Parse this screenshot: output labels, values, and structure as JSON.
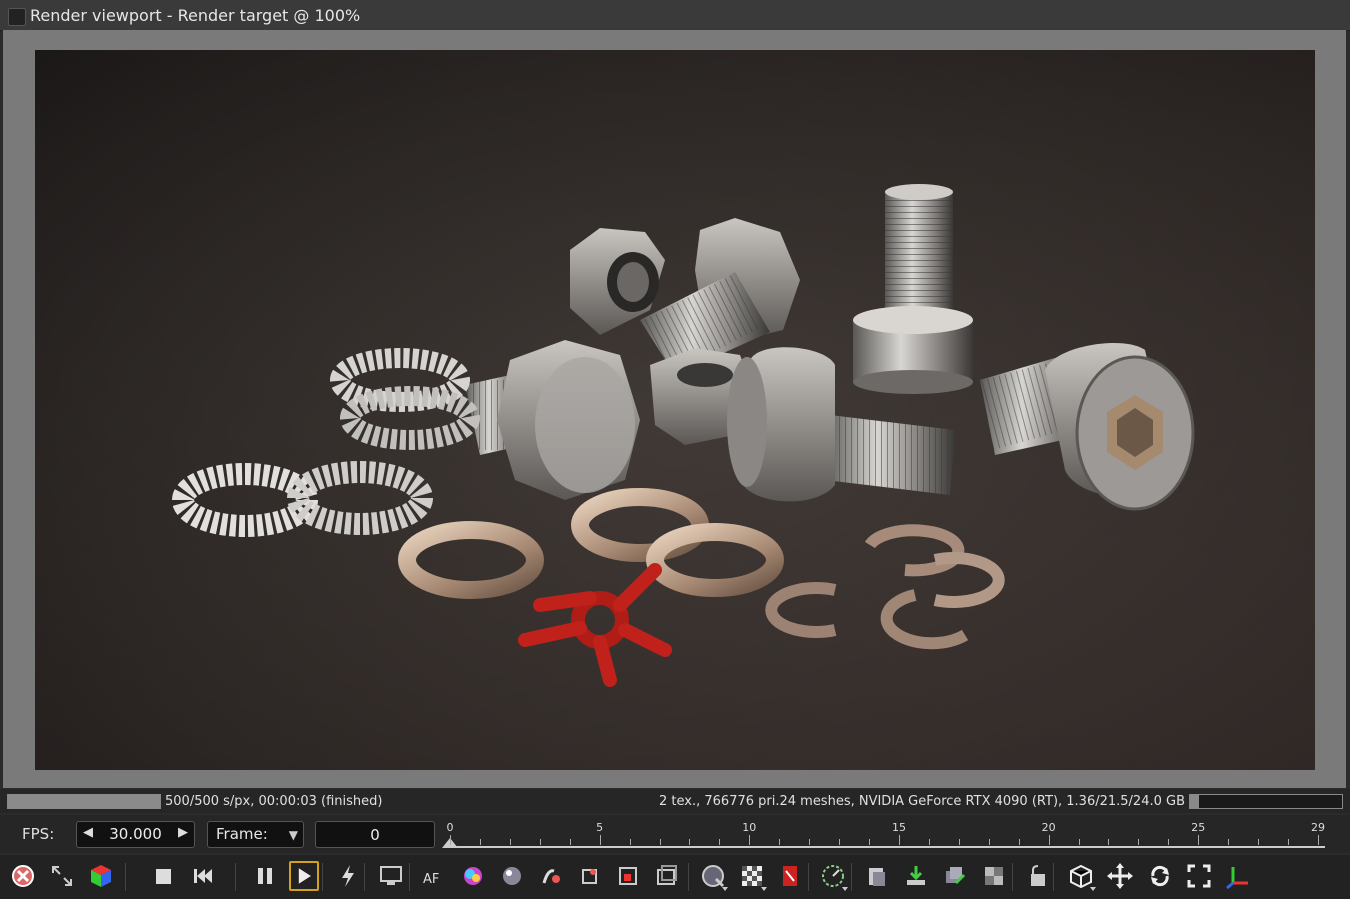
{
  "window": {
    "title": "Render viewport - Render target @ 100%"
  },
  "status": {
    "left_text": "500/500 s/px, 00:00:03 (finished)",
    "right_text": "2 tex., 766776 pri.24 meshes, NVIDIA GeForce RTX 4090 (RT), 1.36/21.5/24.0 GB",
    "render_progress": 1.0,
    "memory_usage": 0.057
  },
  "playback": {
    "fps_label": "FPS:",
    "fps_value": "30.000",
    "frame_label": "Frame:",
    "frame_value": "0",
    "timeline_labels": [
      "0",
      "5",
      "10",
      "15",
      "20",
      "25",
      "29"
    ],
    "current_frame": 0,
    "frame_range": [
      0,
      29
    ]
  },
  "toolbar": {
    "icons": [
      "cancel-render-icon",
      "resize-icon",
      "scene-cube-icon",
      "stop-icon",
      "rewind-icon",
      "pause-icon",
      "play-icon",
      "lightning-icon",
      "display-icon",
      "autofocus-icon",
      "color-picker-icon",
      "material-picker-icon",
      "light-picker-icon",
      "object-picker-icon",
      "region-render-icon",
      "film-region-icon",
      "world-picker-icon",
      "alpha-checker-icon",
      "clay-mode-icon",
      "time-icon",
      "copy-clipboard-icon",
      "save-render-icon",
      "export-passes-icon",
      "render-passes-icon",
      "lock-icon",
      "camera-cube-icon",
      "move-icon",
      "rotate-icon",
      "fit-view-icon",
      "axis-icon"
    ]
  },
  "colors": {
    "accent_selected": "#d4a020",
    "panel": "#262626",
    "viewport_border": "#7a7a7a"
  }
}
